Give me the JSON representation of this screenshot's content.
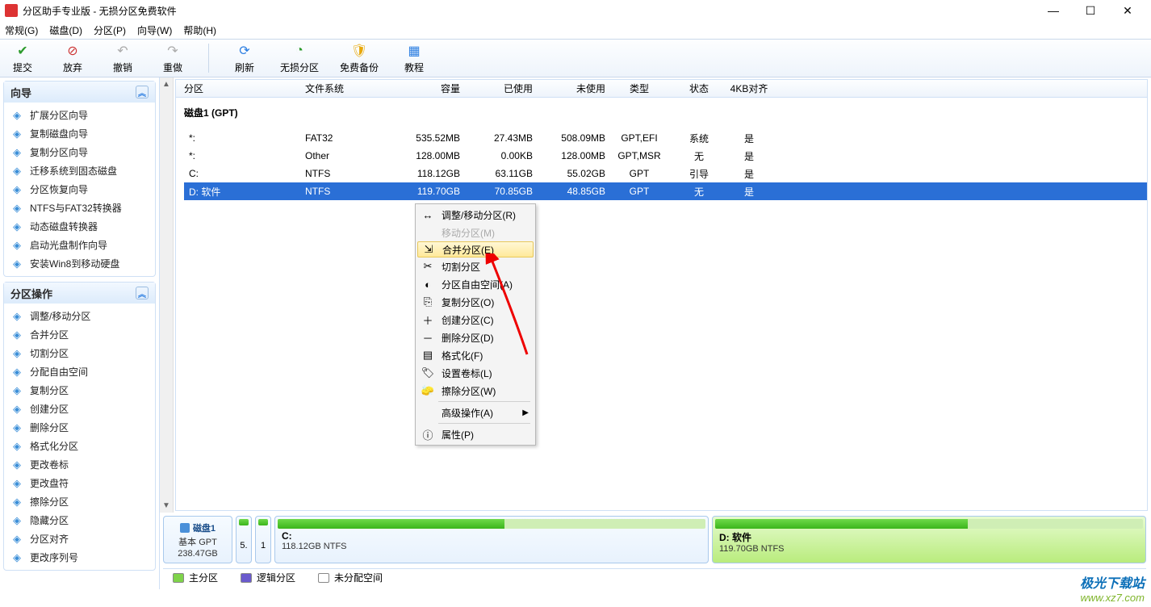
{
  "title": "分区助手专业版 - 无损分区免费软件",
  "menus": [
    "常规(G)",
    "磁盘(D)",
    "分区(P)",
    "向导(W)",
    "帮助(H)"
  ],
  "toolbar": {
    "commit": "提交",
    "discard": "放弃",
    "undo": "撤销",
    "redo": "重做",
    "refresh": "刷新",
    "lossless": "无损分区",
    "backup": "免费备份",
    "tutorial": "教程"
  },
  "panels": {
    "wizard_title": "向导",
    "wizard_items": [
      "扩展分区向导",
      "复制磁盘向导",
      "复制分区向导",
      "迁移系统到固态磁盘",
      "分区恢复向导",
      "NTFS与FAT32转换器",
      "动态磁盘转换器",
      "启动光盘制作向导",
      "安装Win8到移动硬盘"
    ],
    "ops_title": "分区操作",
    "ops_items": [
      "调整/移动分区",
      "合并分区",
      "切割分区",
      "分配自由空间",
      "复制分区",
      "创建分区",
      "删除分区",
      "格式化分区",
      "更改卷标",
      "更改盘符",
      "擦除分区",
      "隐藏分区",
      "分区对齐",
      "更改序列号"
    ]
  },
  "grid": {
    "headers": {
      "partition": "分区",
      "fs": "文件系统",
      "cap": "容量",
      "used": "已使用",
      "free": "未使用",
      "type": "类型",
      "status": "状态",
      "align": "4KB对齐"
    },
    "group": "磁盘1 (GPT)",
    "rows": [
      {
        "p": "*:",
        "fs": "FAT32",
        "cap": "535.52MB",
        "used": "27.43MB",
        "free": "508.09MB",
        "type": "GPT,EFI",
        "status": "系统",
        "align": "是"
      },
      {
        "p": "*:",
        "fs": "Other",
        "cap": "128.00MB",
        "used": "0.00KB",
        "free": "128.00MB",
        "type": "GPT,MSR",
        "status": "无",
        "align": "是"
      },
      {
        "p": "C:",
        "fs": "NTFS",
        "cap": "118.12GB",
        "used": "63.11GB",
        "free": "55.02GB",
        "type": "GPT",
        "status": "引导",
        "align": "是"
      },
      {
        "p": "D: 软件",
        "fs": "NTFS",
        "cap": "119.70GB",
        "used": "70.85GB",
        "free": "48.85GB",
        "type": "GPT",
        "status": "无",
        "align": "是"
      }
    ]
  },
  "contextmenu": {
    "items": [
      {
        "label": "调整/移动分区(R)",
        "ico": "↔"
      },
      {
        "label": "移动分区(M)",
        "disabled": true,
        "ico": ""
      },
      {
        "label": "合并分区(E)",
        "hl": true,
        "ico": "⇲"
      },
      {
        "label": "切割分区",
        "ico": "✂"
      },
      {
        "label": "分区自由空间(A)",
        "ico": "◐"
      },
      {
        "label": "复制分区(O)",
        "ico": "⎘"
      },
      {
        "label": "创建分区(C)",
        "ico": "＋"
      },
      {
        "label": "删除分区(D)",
        "ico": "－"
      },
      {
        "label": "格式化(F)",
        "ico": "▤"
      },
      {
        "label": "设置卷标(L)",
        "ico": "🏷"
      },
      {
        "label": "擦除分区(W)",
        "ico": "🧽"
      },
      {
        "label": "高级操作(A)",
        "arrow": true,
        "ico": ""
      },
      {
        "label": "属性(P)",
        "ico": "ⓘ"
      }
    ]
  },
  "diskmap": {
    "label_name": "磁盘1",
    "label_type": "基本 GPT",
    "label_size": "238.47GB",
    "small1": "5.",
    "small2": "1",
    "c_name": "C:",
    "c_size": "118.12GB NTFS",
    "d_name": "D: 软件",
    "d_size": "119.70GB NTFS"
  },
  "legend": {
    "primary": "主分区",
    "logical": "逻辑分区",
    "unalloc": "未分配空间"
  },
  "watermark": {
    "line1": "极光下载站",
    "line2": "www.xz7.com"
  }
}
